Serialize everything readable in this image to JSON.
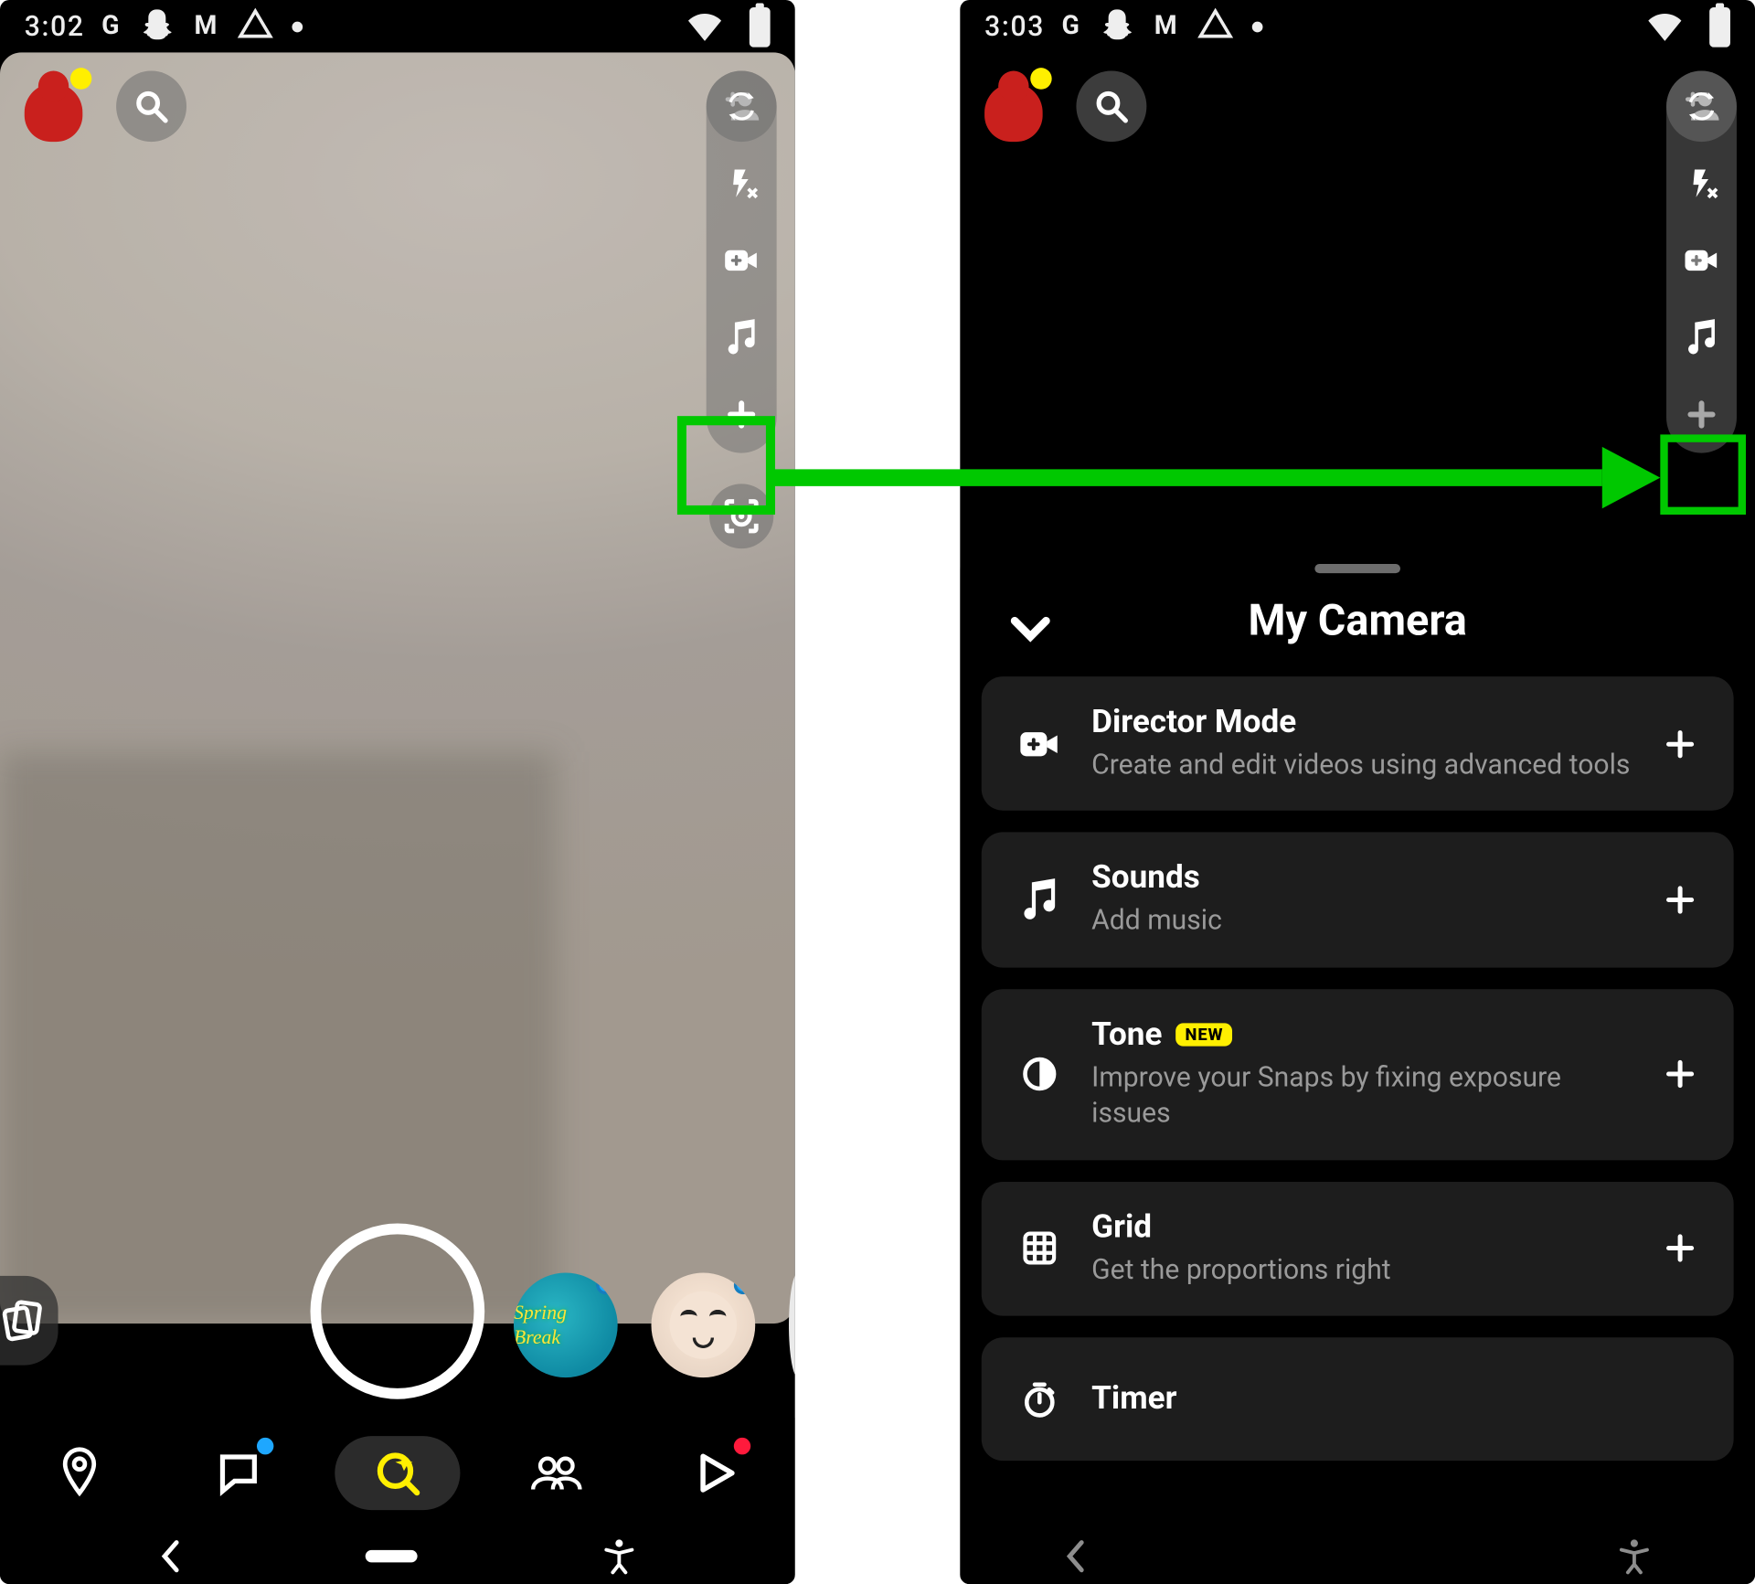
{
  "statusbar": {
    "left": {
      "time": "3:02",
      "icons": [
        "G",
        "ghost",
        "M",
        "drive",
        "dot"
      ]
    },
    "right": {
      "time": "3:03",
      "icons": [
        "G",
        "ghost",
        "M",
        "drive",
        "dot"
      ]
    }
  },
  "side_tools": {
    "flip": "flip-camera-icon",
    "flash": "flash-off-icon",
    "director": "director-mode-icon",
    "sounds": "music-icon",
    "plus": "plus-icon",
    "scan": "scan-icon"
  },
  "lenses": {
    "a_label": "Spring Break",
    "b_label": "Face"
  },
  "sheet": {
    "title": "My Camera",
    "items": [
      {
        "key": "director",
        "title": "Director Mode",
        "sub": "Create and edit videos using advanced tools",
        "badge": ""
      },
      {
        "key": "sounds",
        "title": "Sounds",
        "sub": "Add music",
        "badge": ""
      },
      {
        "key": "tone",
        "title": "Tone",
        "sub": "Improve your Snaps by fixing exposure issues",
        "badge": "NEW"
      },
      {
        "key": "grid",
        "title": "Grid",
        "sub": "Get the proportions right",
        "badge": ""
      },
      {
        "key": "timer",
        "title": "Timer",
        "sub": "",
        "badge": ""
      }
    ]
  },
  "nav": {
    "items": [
      "map",
      "chat",
      "camera",
      "stories",
      "spotlight"
    ]
  }
}
